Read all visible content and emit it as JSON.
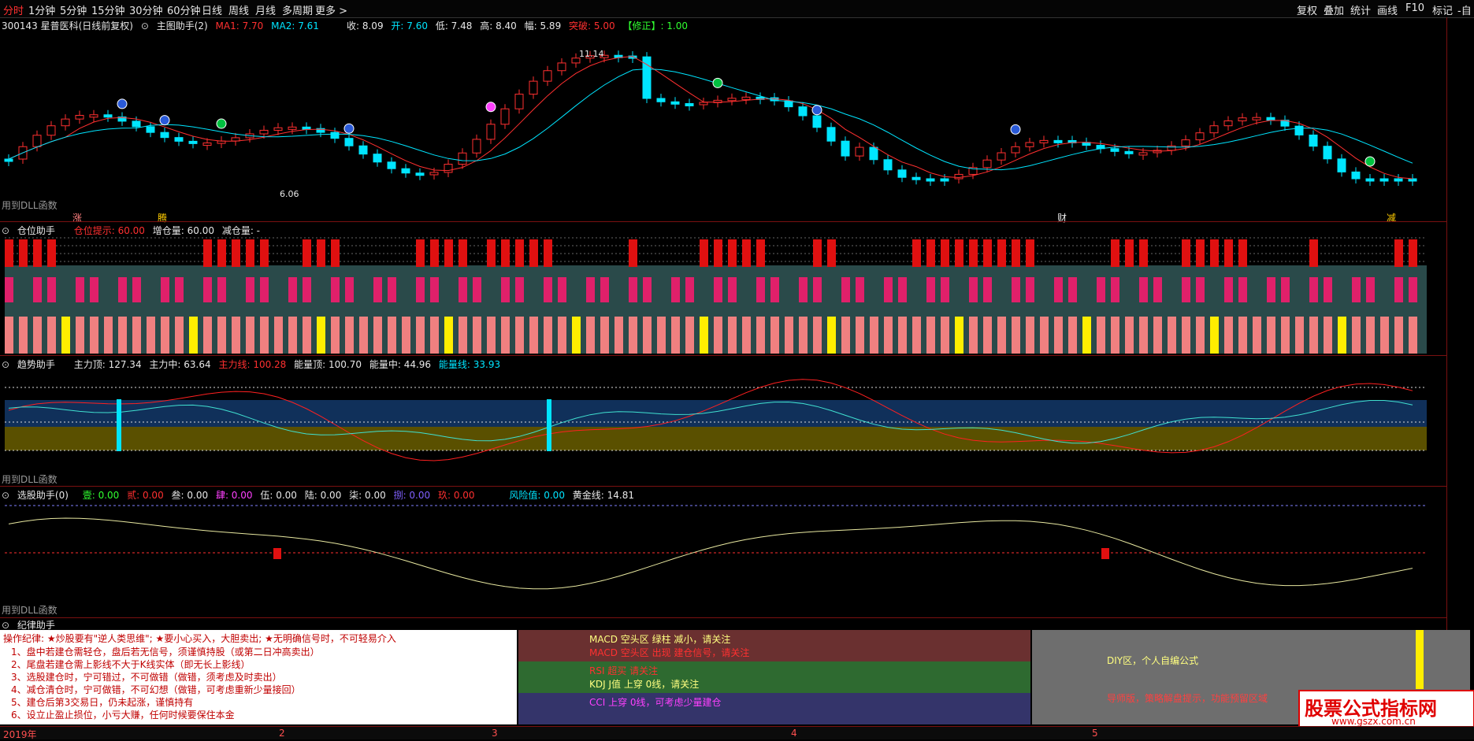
{
  "menu": {
    "items": [
      "分时",
      "1分钟",
      "5分钟",
      "15分钟",
      "30分钟",
      "60分钟",
      "日线",
      "周线",
      "月线",
      "多周期",
      "更多 >"
    ],
    "active": "分时",
    "right_items": [
      "复权",
      "叠加",
      "统计",
      "画线",
      "F10",
      "标记",
      "-自"
    ]
  },
  "stock": {
    "title": "300143 星普医科(日线前复权)",
    "indicator": "主图助手(2)",
    "ma1": "MA1: 7.70",
    "ma2": "MA2: 7.61",
    "close": "收: 8.09",
    "open": "开: 7.60",
    "low": "低: 7.48",
    "high": "高: 8.40",
    "amp": "幅: 5.89",
    "breakout": "突破: 5.00",
    "fix": "【修正】: 1.00",
    "dll_note": "用到DLL函数",
    "price_high_label": "11.14",
    "price_low_label": "6.06",
    "bottom_tags": [
      "涨",
      "腾",
      "财",
      "减"
    ]
  },
  "panel_position": {
    "name": "仓位助手",
    "hint": "仓位提示: 60.00",
    "add": "增仓量: 60.00",
    "reduce": "减仓量: -"
  },
  "panel_trend": {
    "name": "趋势助手",
    "v1": "主力顶: 127.34",
    "v2": "主力中: 63.64",
    "v3": "主力线: 100.28",
    "v4": "能量顶: 100.70",
    "v5": "能量中: 44.96",
    "v6": "能量线: 33.93",
    "dll_note": "用到DLL函数"
  },
  "panel_select": {
    "name": "选股助手(0)",
    "items": [
      "壹: 0.00",
      "贰: 0.00",
      "叁: 0.00",
      "肆: 0.00",
      "伍: 0.00",
      "陆: 0.00",
      "柒: 0.00",
      "捌: 0.00",
      "玖: 0.00"
    ],
    "risk": "风险值: 0.00",
    "gold": "黄金线: 14.81",
    "dll_note": "用到DLL函数"
  },
  "panel_discipline": {
    "name": "纪律助手",
    "rule_header": "操作纪律: ★炒股要有\"逆人类思维\"; ★要小心买入，大胆卖出; ★无明确信号时，不可轻易介入",
    "rules": [
      "1、盘中若建仓需轻仓，盘后若无信号，须谨慎持股（或第二日冲高卖出）",
      "2、尾盘若建仓需上影线不大于K线实体（即无长上影线）",
      "3、选股建仓时，宁可错过，不可做错（做错，须考虑及时卖出）",
      "4、减仓清仓时，宁可做错，不可幻想（做错，可考虑重新少量接回）",
      "5、建仓后第3交易日，仍未起涨，谨慎持有",
      "6、设立止盈止损位，小亏大赚，任何时候要保住本金"
    ],
    "signals": [
      "MACD 空头区 绿柱 减小，请关注",
      "MACD 空头区 出现 建仓信号，请关注",
      "RSI 超买 请关注",
      "KDJ J值 上穿 0线，请关注",
      "CCI 上穿 0线，可考虑少量建仓"
    ],
    "diy_title": "DIY区，个人自编公式",
    "diy_note": "导师版，策略解盘提示，功能预留区域"
  },
  "watermark": {
    "line1": "股票公式指标网",
    "line2": "www.gszx.com.cn"
  },
  "footer": {
    "dates": [
      "2019年",
      "2",
      "3",
      "4",
      "5"
    ]
  },
  "colors": {
    "up": "#ff3030",
    "down": "#00e5ff",
    "ma1": "#ff3030",
    "ma2": "#00e5ff",
    "grid": "#7a1010"
  }
}
